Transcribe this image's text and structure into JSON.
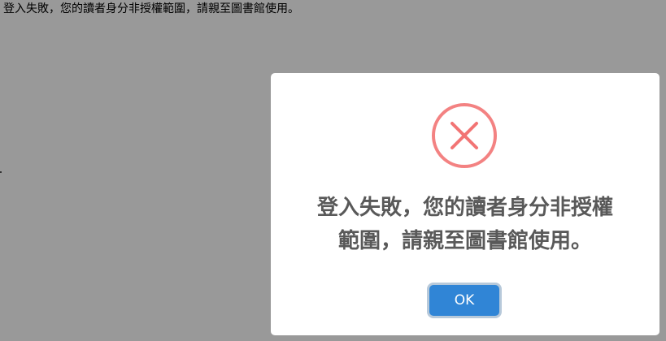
{
  "page": {
    "message": "登入失敗，您的讀者身分非授權範圍，請親至圖書館使用。"
  },
  "modal": {
    "icon": "error-x-icon",
    "message": "登入失敗，您的讀者身分非授權範圍，請親至圖書館使用。",
    "button_label": "OK"
  },
  "colors": {
    "overlay": "#999999",
    "error_icon": "#f27474",
    "message_text": "#595959",
    "button": "#3085d6"
  }
}
